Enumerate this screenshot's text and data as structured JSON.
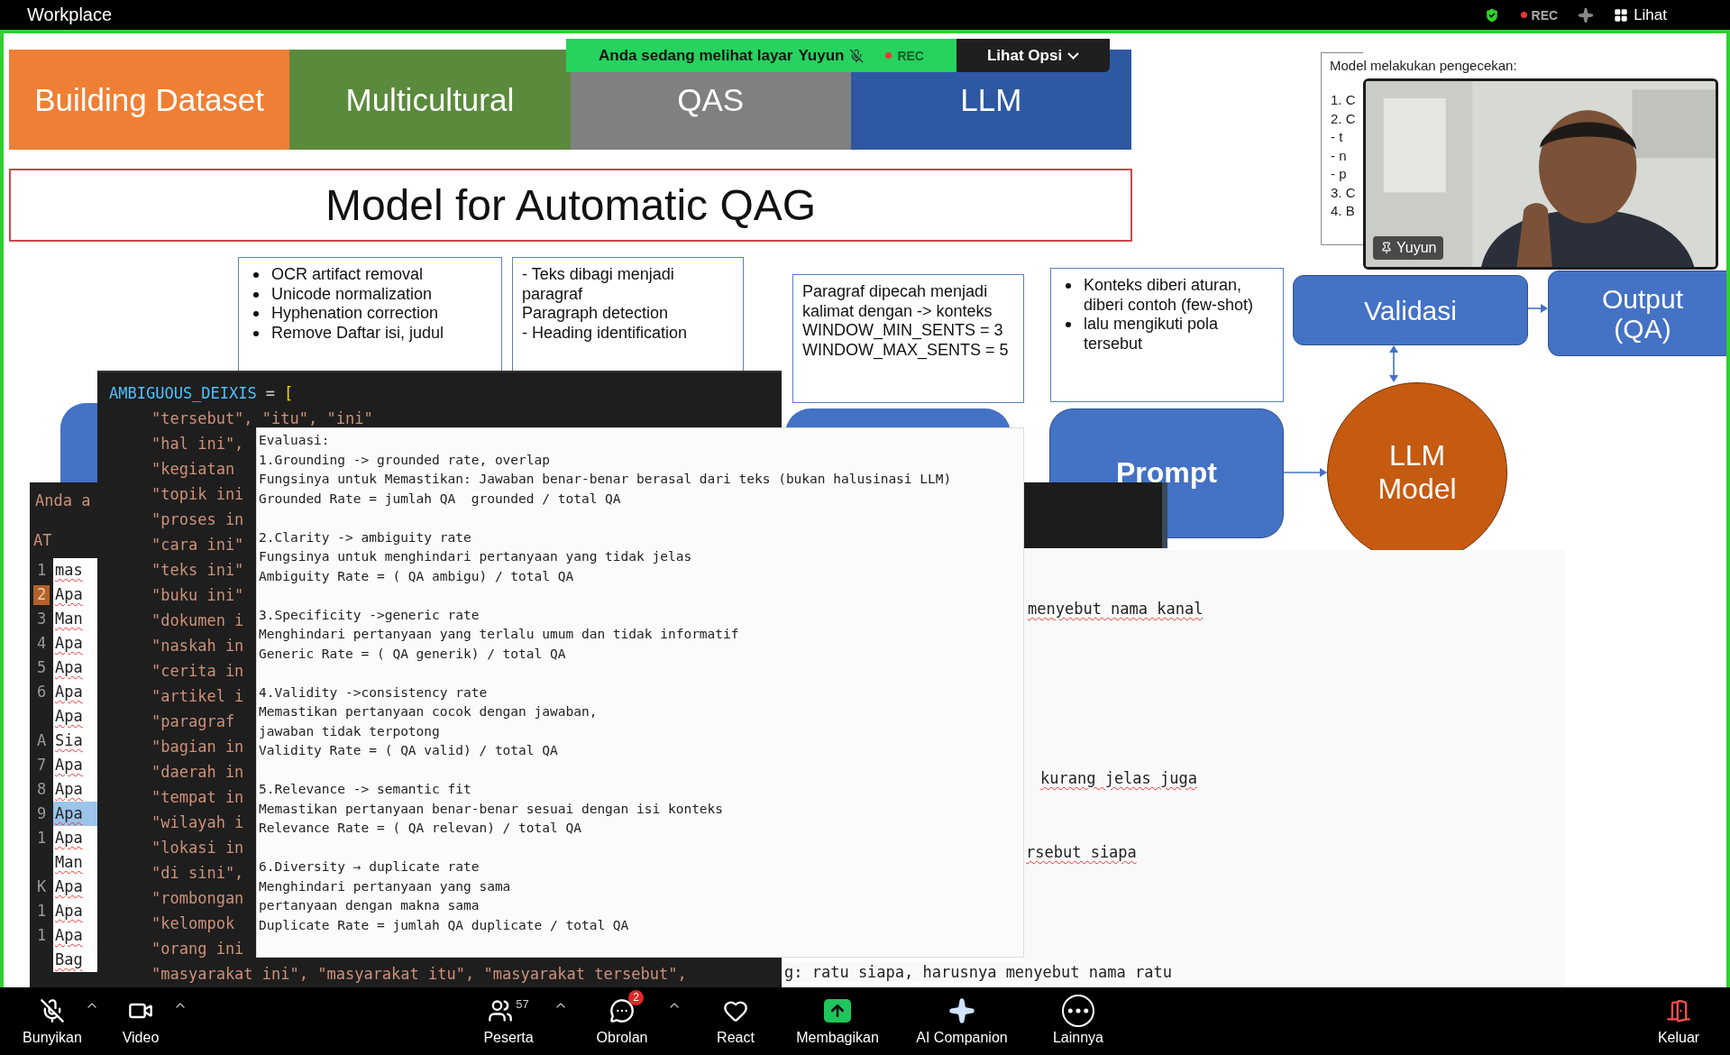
{
  "app": {
    "title": "Workplace",
    "rec": "REC",
    "view": "Lihat"
  },
  "share_banner": {
    "message": "Anda sedang melihat layar",
    "presenter": "Yuyun",
    "presenter_muted": true,
    "rec": "REC",
    "options": "Lihat Opsi"
  },
  "slide": {
    "tabs": [
      {
        "label": "Building Dataset",
        "color": "#ef7f35"
      },
      {
        "label": "Multicultural",
        "color": "#5a8a3b"
      },
      {
        "label": "QAS",
        "color": "#808080"
      },
      {
        "label": "LLM",
        "color": "#2f58a3"
      }
    ],
    "title": "Model for  Automatic QAG",
    "boxes": [
      {
        "kind": "bullets",
        "items": [
          "OCR artifact removal",
          "Unicode normalization",
          "Hyphenation correction",
          "Remove Daftar isi, judul"
        ]
      },
      {
        "kind": "plain",
        "items": [
          "- Teks dibagi menjadi paragraf",
          "Paragraph detection",
          "- Heading identification"
        ]
      },
      {
        "kind": "plain",
        "items": [
          "Paragraf dipecah menjadi kalimat dengan -> konteks",
          "WINDOW_MIN_SENTS = 3",
          "WINDOW_MAX_SENTS = 5"
        ]
      },
      {
        "kind": "bullets",
        "items": [
          "Konteks diberi aturan, diberi contoh (few-shot)",
          "lalu mengikuti pola tersebut"
        ]
      }
    ],
    "side_note": {
      "heading": "Model melakukan pengecekan:",
      "lines": [
        "1. C",
        "2. C",
        "- t",
        "- n",
        "- p",
        "3. C",
        "4. B"
      ]
    },
    "flow": {
      "validation": "Validasi",
      "output": [
        "Output",
        "(QA)"
      ],
      "prompt": "Prompt",
      "model": [
        "LLM",
        "Model"
      ]
    }
  },
  "video": {
    "participant": "Yuyun",
    "pinned": true
  },
  "back_window": {
    "title": "Anda a",
    "section": "AT",
    "rows": [
      {
        "gutter": "1",
        "text": "mas",
        "marked": false,
        "selected": false
      },
      {
        "gutter": "2",
        "text": "Apa",
        "marked": true,
        "selected": false
      },
      {
        "gutter": "3",
        "text": "Man",
        "marked": false,
        "selected": false
      },
      {
        "gutter": "4",
        "text": "Apa",
        "marked": false,
        "selected": false
      },
      {
        "gutter": "5",
        "text": "Apa",
        "marked": false,
        "selected": false
      },
      {
        "gutter": "6",
        "text": "Apa",
        "marked": false,
        "selected": false
      },
      {
        "text": "Apa",
        "selected": false
      },
      {
        "gutter": "A",
        "text": "Sia",
        "marked": false,
        "selected": false
      },
      {
        "gutter": "7",
        "text": "Apa",
        "marked": false,
        "selected": false
      },
      {
        "gutter": "8",
        "text": "Apa",
        "marked": false,
        "selected": false
      },
      {
        "gutter": "9",
        "text": "Apa",
        "marked": false,
        "selected": true
      },
      {
        "gutter": "1",
        "text": "Apa",
        "marked": false,
        "selected": false
      },
      {
        "text": "Man",
        "selected": false
      },
      {
        "gutter": "K",
        "text": "Apa",
        "marked": false,
        "selected": false
      },
      {
        "gutter": "1",
        "text": "Apa",
        "marked": false,
        "selected": false
      },
      {
        "gutter": "1",
        "text": "Apa",
        "marked": false,
        "selected": false
      },
      {
        "text": "Bag",
        "selected": false
      }
    ]
  },
  "code_window": {
    "variable": "AMBIGUOUS_DEIXIS",
    "operator": "=",
    "bracket": "[",
    "lines": [
      "\"tersebut\", \"itu\", \"ini\"",
      "\"hal ini\",",
      "\"kegiatan",
      "\"topik ini",
      "\"proses in",
      "\"cara ini\"",
      "\"teks ini\"",
      "\"buku ini\"",
      "\"dokumen i",
      "\"naskah in",
      "\"cerita in",
      "\"artikel i",
      "\"paragraf",
      "\"bagian in",
      "\"daerah in",
      "\"tempat in",
      "\"wilayah i",
      "\"lokasi in",
      "\"di sini\",",
      "\"rombongan",
      "\"kelompok",
      "\"orang ini",
      "\"masyarakat ini\", \"masyarakat itu\", \"masyarakat tersebut\","
    ]
  },
  "evaluation_popup": {
    "heading": "Evaluasi:",
    "sections": [
      {
        "lines": [
          "1.Grounding -> grounded rate, overlap",
          "Fungsinya untuk Memastikan: Jawaban benar-benar berasal dari teks (bukan halusinasi LLM)",
          "Grounded Rate = jumlah QA  grounded / total QA"
        ]
      },
      {
        "lines": [
          "2.Clarity -> ambiguity rate",
          "Fungsinya untuk menghindari pertanyaan yang tidak jelas",
          "Ambiguity Rate = ( QA ambigu) / total QA"
        ]
      },
      {
        "lines": [
          "3.Specificity ->generic rate",
          "Menghindari pertanyaan yang terlalu umum dan tidak informatif",
          "Generic Rate = ( QA generik) / total QA"
        ]
      },
      {
        "lines": [
          "4.Validity ->consistency rate",
          "Memastikan pertanyaan cocok dengan jawaban,",
          "jawaban tidak terpotong",
          "Validity Rate = ( QA valid) / total QA"
        ]
      },
      {
        "lines": [
          "5.Relevance -> semantic fit",
          "Memastikan pertanyaan benar-benar sesuai dengan isi konteks",
          "Relevance Rate = ( QA relevan) / total QA"
        ]
      },
      {
        "lines": [
          "6.Diversity → duplicate rate",
          "Menghindari pertanyaan yang sama",
          "pertanyaan dengan makna sama",
          "Duplicate Rate = jumlah QA duplicate / total QA"
        ]
      }
    ]
  },
  "document_panel": {
    "lines": [
      "menyebut nama kanal",
      "kurang jelas juga",
      "rsebut siapa"
    ],
    "tail": "g: ratu siapa, harusnya menyebut nama ratu"
  },
  "toolbar": {
    "items": [
      {
        "kind": "mic",
        "label": "Bunyikan",
        "muted": true,
        "caret": true
      },
      {
        "kind": "video",
        "label": "Video",
        "caret": true
      },
      {
        "kind": "participants",
        "label": "Peserta",
        "count": "57",
        "caret": true
      },
      {
        "kind": "chat",
        "label": "Obrolan",
        "badge": "2",
        "caret": true
      },
      {
        "kind": "react",
        "label": "React",
        "caret": false
      },
      {
        "kind": "share",
        "label": "Membagikan",
        "caret": false
      },
      {
        "kind": "ai",
        "label": "AI Companion",
        "caret": false
      },
      {
        "kind": "more",
        "label": "Lainnya",
        "caret": false
      }
    ],
    "leave": "Keluar"
  }
}
